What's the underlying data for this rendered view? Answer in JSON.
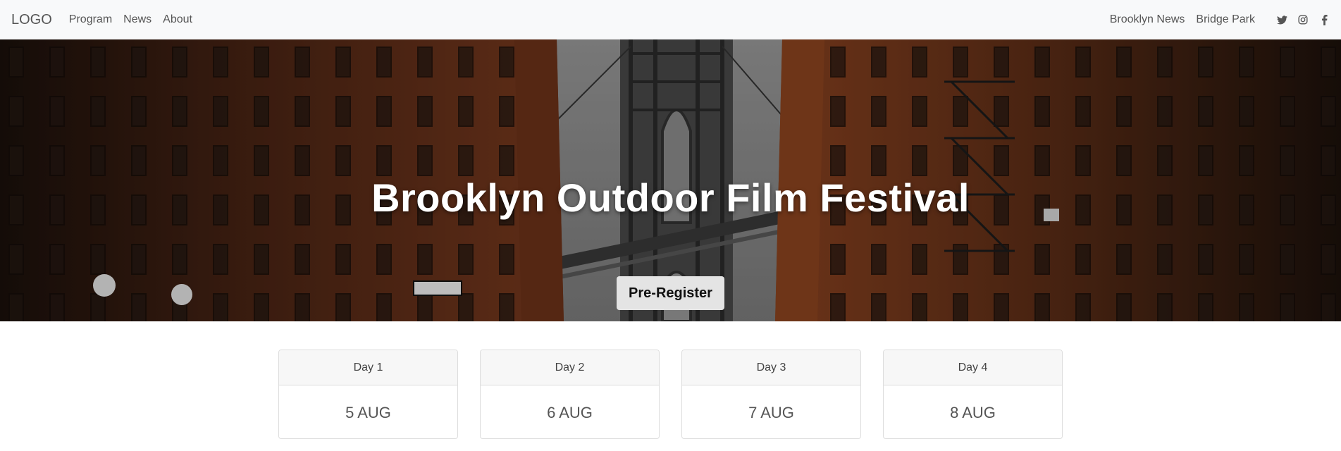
{
  "nav": {
    "logo": "LOGO",
    "links": [
      "Program",
      "News",
      "About"
    ],
    "right_links": [
      "Brooklyn News",
      "Bridge Park"
    ],
    "social_icons": [
      "twitter-icon",
      "instagram-icon",
      "facebook-icon"
    ]
  },
  "hero": {
    "title": "Brooklyn Outdoor Film Festival",
    "button_label": "Pre-Register"
  },
  "days": [
    {
      "label": "Day 1",
      "date": "5 AUG"
    },
    {
      "label": "Day 2",
      "date": "6 AUG"
    },
    {
      "label": "Day 3",
      "date": "7 AUG"
    },
    {
      "label": "Day 4",
      "date": "8 AUG"
    }
  ],
  "colors": {
    "navbar_bg": "#f8f9fa",
    "brick": "#7a3a1e",
    "button_bg": "#e4e4e4"
  }
}
